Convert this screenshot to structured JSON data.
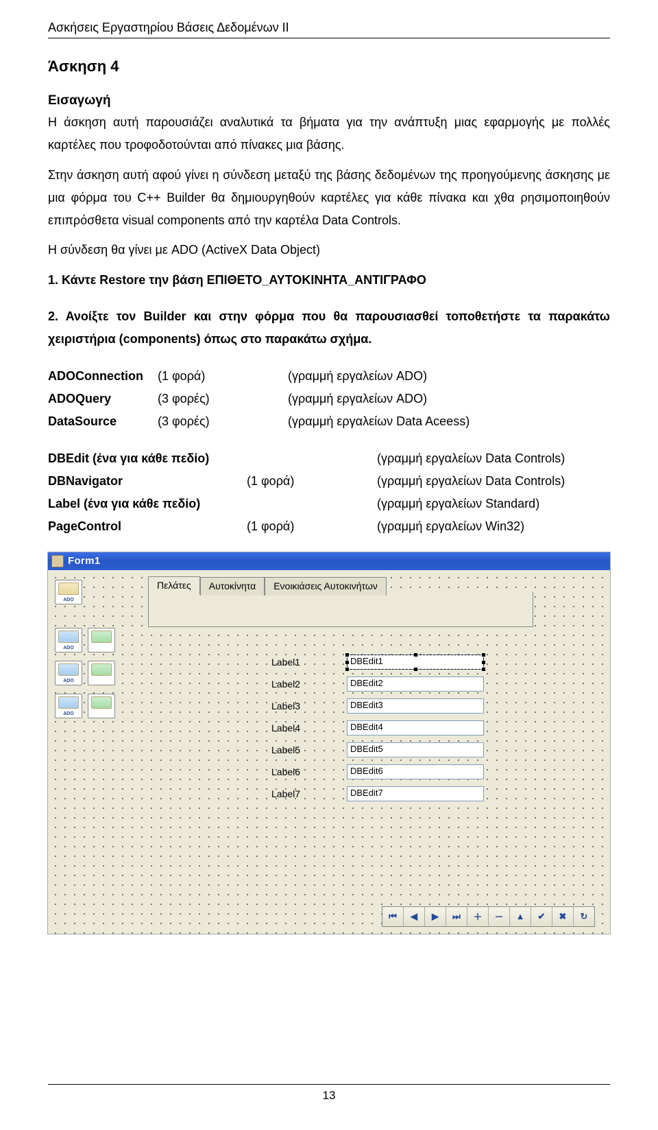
{
  "running_header": "Ασκήσεις Εργαστηρίου Βάσεις Δεδομένων ΙΙ",
  "title": "Άσκηση 4",
  "intro_heading": "Εισαγωγή",
  "para1": "Η άσκηση αυτή παρουσιάζει αναλυτικά τα βήματα για την ανάπτυξη μιας εφαρμογής με πολλές καρτέλες που τροφοδοτούνται από πίνακες μια βάσης.",
  "para2": "Στην άσκηση αυτή αφού γίνει η σύνδεση μεταξύ της βάσης δεδομένων της προηγούμενης άσκησης με μια φόρμα του  C++ Builder θα δημιουργηθούν καρτέλες για κάθε πίνακα και χθα ρησιμοποιηθούν επιπρόσθετα visual components από την καρτέλα Data Controls.",
  "para3": "Η σύνδεση θα γίνει με ADO (ActiveX  Data Object)",
  "step1": "1. Κάντε Restore την βάση ΕΠΙΘΕΤΟ_ΑΥΤΟΚΙΝΗΤΑ_ΑΝΤΙΓΡΑΦΟ",
  "step2": "2. Ανοίξτε τον Builder και στην φόρμα που θα παρουσιασθεί τοποθετήστε τα παρακάτω χειριστήρια (components) όπως στο παρακάτω σχήμα.",
  "table1": [
    {
      "c1": "ADOConnection",
      "c2": "(1 φορά)",
      "c3": "(γραμμή εργαλείων ADO)"
    },
    {
      "c1": "ADOQuery",
      "c2": "(3 φορές)",
      "c3": "(γραμμή εργαλείων ADO)"
    },
    {
      "c1": "DataSource",
      "c2": "(3 φορές)",
      "c3": "(γραμμή εργαλείων Data Aceess)"
    }
  ],
  "table2": [
    {
      "c1": "DBEdit (ένα για κάθε πεδίο)",
      "c2": "",
      "c3": "(γραμμή εργαλείων Data Controls)"
    },
    {
      "c1": "DBNavigator",
      "c2": "(1 φορά)",
      "c3": "(γραμμή εργαλείων Data Controls)"
    },
    {
      "c1": "Label (ένα για κάθε πεδίο)",
      "c2": "",
      "c3": "(γραμμή εργαλείων Standard)"
    },
    {
      "c1": "PageControl",
      "c2": "(1 φορά)",
      "c3": "(γραμμή εργαλείων Win32)"
    }
  ],
  "form": {
    "title": "Form1",
    "side_components": [
      {
        "type": "conn",
        "caption": "ADO"
      },
      {
        "type": "spacer"
      },
      {
        "type": "query",
        "caption": "ADO"
      },
      {
        "type": "ds",
        "caption": ""
      },
      {
        "type": "query",
        "caption": "ADO"
      },
      {
        "type": "ds",
        "caption": ""
      },
      {
        "type": "query",
        "caption": "ADO"
      },
      {
        "type": "ds",
        "caption": ""
      }
    ],
    "tabs": [
      "Πελάτες",
      "Αυτοκίνητα",
      "Ενοικιάσεις Αυτοκινήτων"
    ],
    "active_tab": 0,
    "rows": [
      {
        "label": "Label1",
        "edit": "DBEdit1",
        "selected": true
      },
      {
        "label": "Label2",
        "edit": "DBEdit2",
        "selected": false
      },
      {
        "label": "Label3",
        "edit": "DBEdit3",
        "selected": false
      },
      {
        "label": "Label4",
        "edit": "DBEdit4",
        "selected": false
      },
      {
        "label": "Label5",
        "edit": "DBEdit5",
        "selected": false
      },
      {
        "label": "Label6",
        "edit": "DBEdit6",
        "selected": false
      },
      {
        "label": "Label7",
        "edit": "DBEdit7",
        "selected": false
      }
    ],
    "navigator": [
      "⏮",
      "◀",
      "▶",
      "⏭",
      "＋",
      "－",
      "▲",
      "✔",
      "✖",
      "↻"
    ]
  },
  "page_number": "13"
}
